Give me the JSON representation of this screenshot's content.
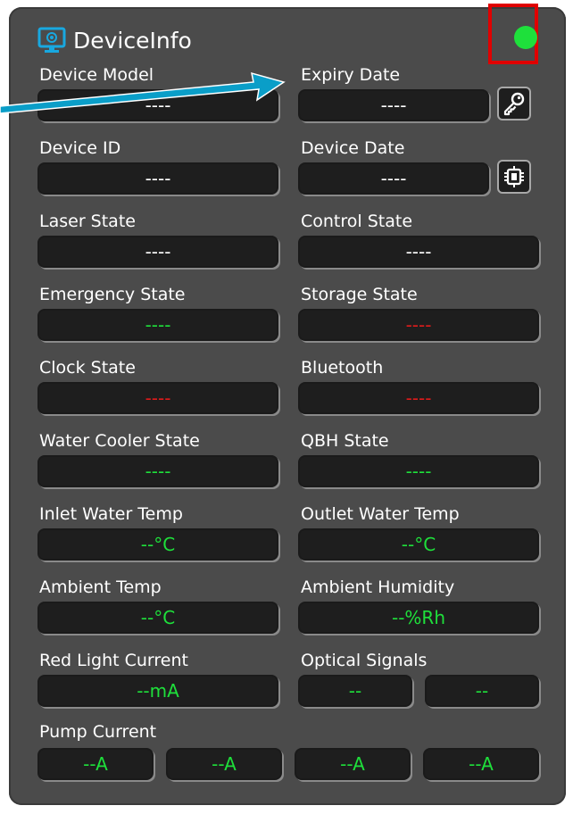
{
  "panel": {
    "title": "DeviceInfo",
    "status_color": "#1ee03b"
  },
  "colors": {
    "green": "#1ee03b",
    "red": "#e01b1b",
    "white": "#ffffff",
    "arrow": "#0a9ec8",
    "frame": "#e00000"
  },
  "fields": {
    "device_model": {
      "label": "Device Model",
      "value": "----",
      "color": "white"
    },
    "expiry_date": {
      "label": "Expiry Date",
      "value": "----",
      "color": "white"
    },
    "device_id": {
      "label": "Device ID",
      "value": "----",
      "color": "white"
    },
    "device_date": {
      "label": "Device Date",
      "value": "----",
      "color": "white"
    },
    "laser_state": {
      "label": "Laser State",
      "value": "----",
      "color": "white"
    },
    "control_state": {
      "label": "Control State",
      "value": "----",
      "color": "white"
    },
    "emergency_state": {
      "label": "Emergency State",
      "value": "----",
      "color": "green"
    },
    "storage_state": {
      "label": "Storage State",
      "value": "----",
      "color": "red"
    },
    "clock_state": {
      "label": "Clock State",
      "value": "----",
      "color": "red"
    },
    "bluetooth": {
      "label": "Bluetooth",
      "value": "----",
      "color": "red"
    },
    "water_cooler_state": {
      "label": "Water Cooler State",
      "value": "----",
      "color": "green"
    },
    "qbh_state": {
      "label": "QBH State",
      "value": "----",
      "color": "green"
    },
    "inlet_water_temp": {
      "label": "Inlet Water Temp",
      "value": "--°C",
      "color": "green"
    },
    "outlet_water_temp": {
      "label": "Outlet Water Temp",
      "value": "--°C",
      "color": "green"
    },
    "ambient_temp": {
      "label": "Ambient Temp",
      "value": "--°C",
      "color": "green"
    },
    "ambient_humidity": {
      "label": "Ambient Humidity",
      "value": "--%Rh",
      "color": "green"
    },
    "red_light_current": {
      "label": "Red Light Current",
      "value": "--mA",
      "color": "green"
    }
  },
  "optical_signals": {
    "label": "Optical Signals",
    "values": [
      "--",
      "--"
    ]
  },
  "pump_current": {
    "label": "Pump Current",
    "values": [
      "--A",
      "--A",
      "--A",
      "--A"
    ]
  },
  "icons": {
    "key_button": "key-icon",
    "chip_button": "chip-icon",
    "title_icon": "monitor-icon"
  }
}
